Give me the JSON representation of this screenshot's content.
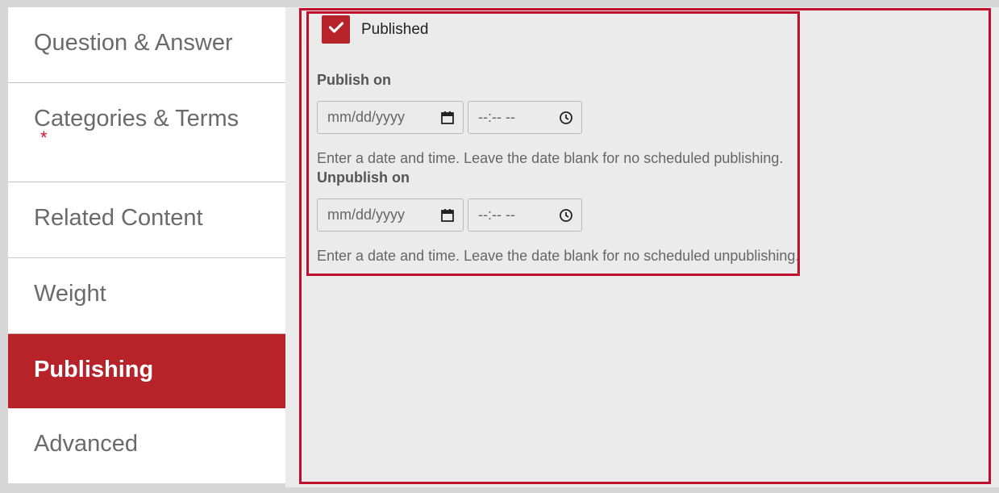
{
  "sidebar": {
    "tabs": [
      {
        "label": "Question & Answer"
      },
      {
        "label": "Categories & Terms",
        "required": "*"
      },
      {
        "label": "Related Content"
      },
      {
        "label": "Weight"
      },
      {
        "label": "Publishing"
      },
      {
        "label": "Advanced"
      }
    ]
  },
  "publishing": {
    "published_label": "Published",
    "published_checked": true,
    "publish_on": {
      "label": "Publish on",
      "date_placeholder": "mm/dd/yyyy",
      "time_placeholder": "--:-- --",
      "help": "Enter a date and time. Leave the date blank for no scheduled publishing."
    },
    "unpublish_on": {
      "label": "Unpublish on",
      "date_placeholder": "mm/dd/yyyy",
      "time_placeholder": "--:-- --",
      "help": "Enter a date and time. Leave the date blank for no scheduled unpublishing."
    }
  },
  "colors": {
    "accent": "#b8232a",
    "highlight_border": "#c0102b",
    "panel_bg": "#ebebeb"
  },
  "icons": {
    "checkbox": "check-icon",
    "date": "calendar-icon",
    "time": "clock-icon"
  }
}
